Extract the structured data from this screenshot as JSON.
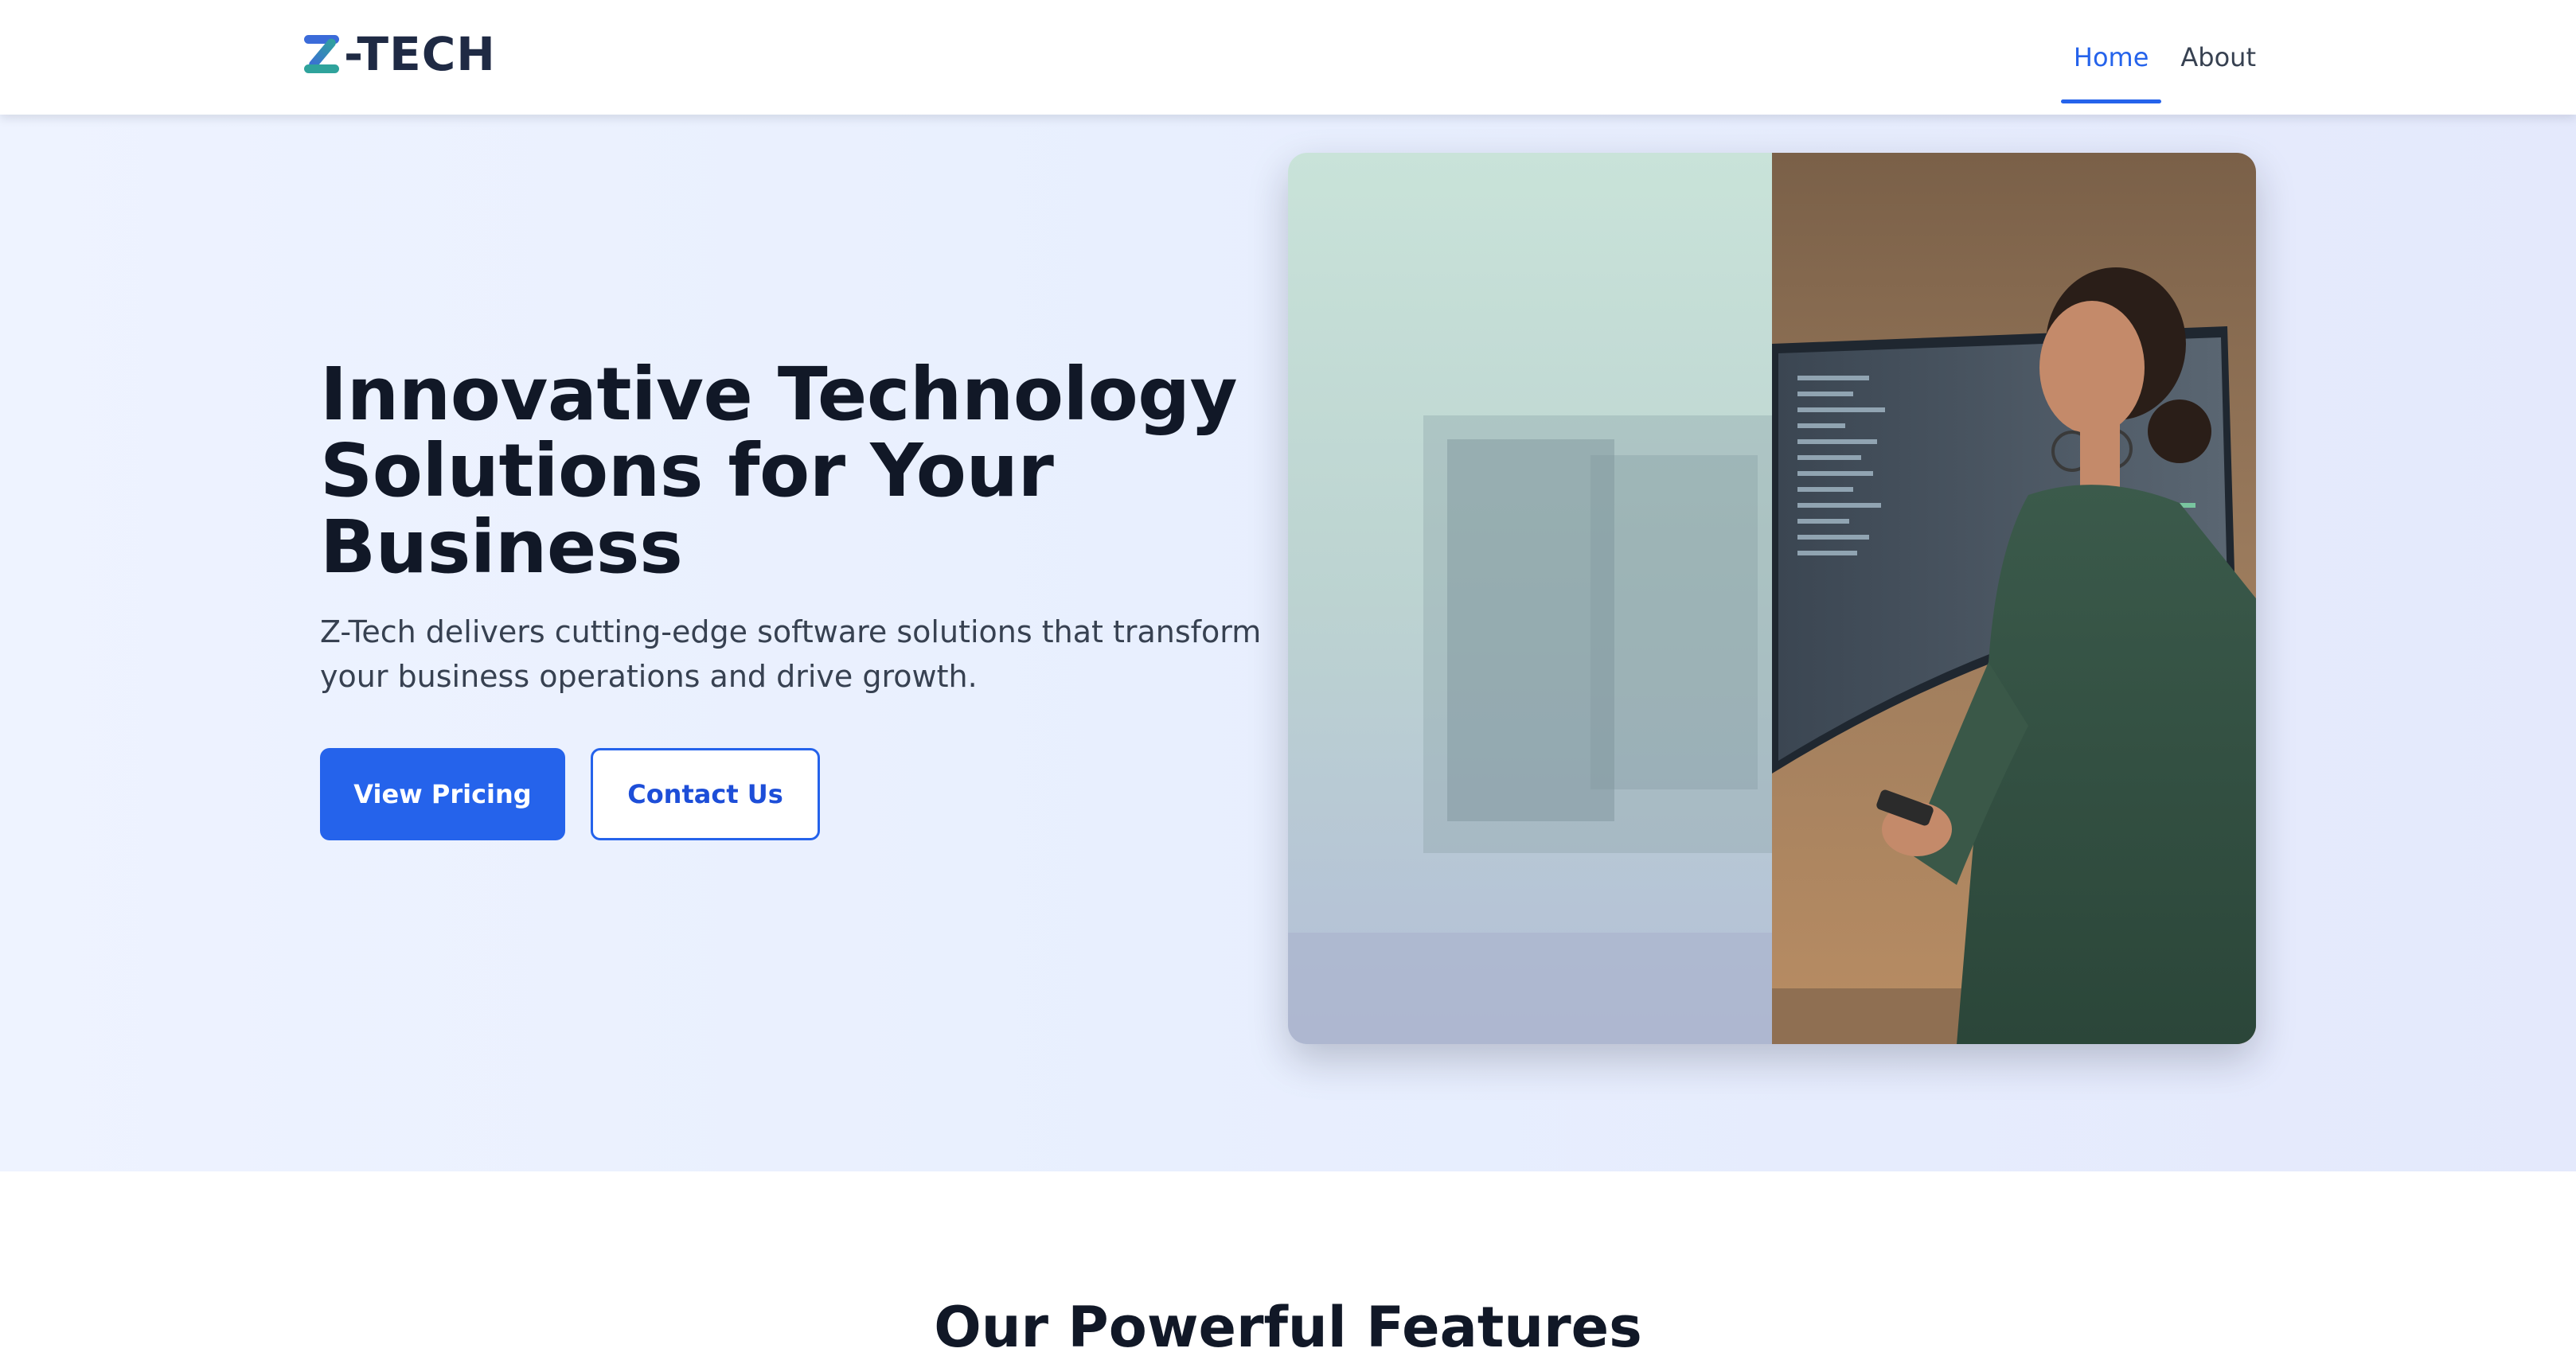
{
  "header": {
    "logo_text": "-TECH",
    "logo_icon": "z-logo-icon",
    "nav": [
      {
        "label": "Home",
        "active": true
      },
      {
        "label": "About",
        "active": false
      }
    ]
  },
  "hero": {
    "title": "Innovative Technology Solutions for Your Business",
    "subtitle": "Z-Tech delivers cutting-edge software solutions that transform your business operations and drive growth.",
    "primary_button": "View Pricing",
    "secondary_button": "Contact Us",
    "image": "woman-at-computer-photo"
  },
  "features": {
    "title": "Our Powerful Features"
  },
  "colors": {
    "accent": "#2563eb",
    "text_dark": "#111827",
    "text_body": "#374151",
    "hero_bg": "#eaf0fe"
  }
}
